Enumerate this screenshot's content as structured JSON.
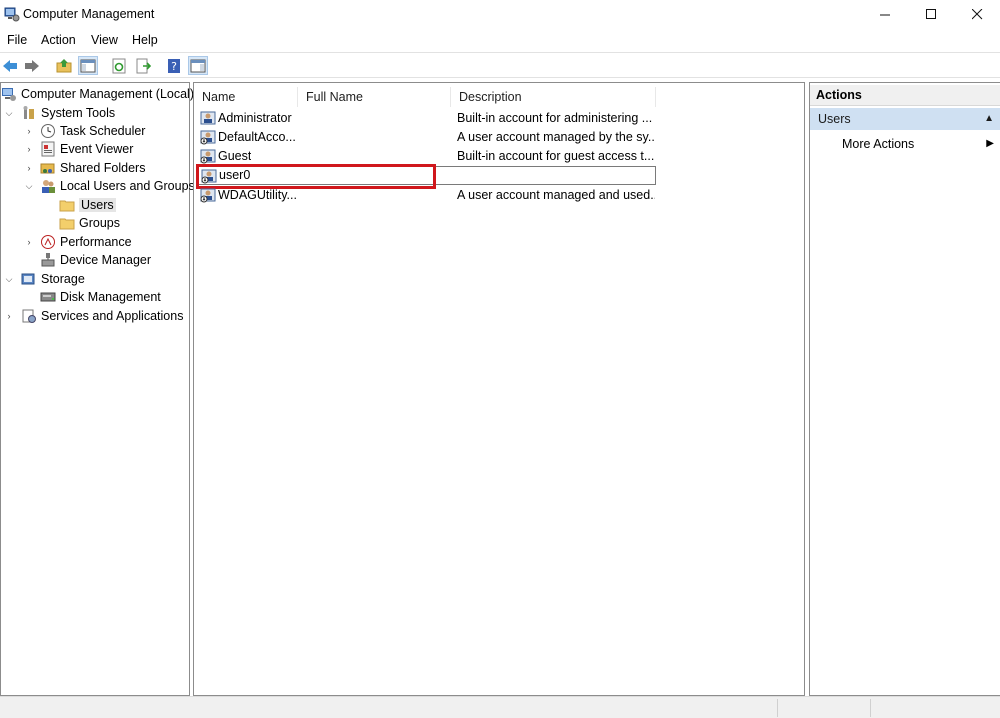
{
  "window": {
    "title": "Computer Management"
  },
  "menu": [
    "File",
    "Action",
    "View",
    "Help"
  ],
  "toolbar": {
    "icons": [
      "back-icon",
      "forward-icon",
      "up-folder-icon",
      "show-hide-tree-icon",
      "refresh-icon",
      "export-list-icon",
      "help-icon",
      "properties-icon"
    ]
  },
  "tree": {
    "root": "Computer Management (Local)",
    "system_tools": "System Tools",
    "task_scheduler": "Task Scheduler",
    "event_viewer": "Event Viewer",
    "shared_folders": "Shared Folders",
    "local_users_groups": "Local Users and Groups",
    "users": "Users",
    "groups": "Groups",
    "performance": "Performance",
    "device_manager": "Device Manager",
    "storage": "Storage",
    "disk_management": "Disk Management",
    "services_apps": "Services and Applications"
  },
  "list": {
    "columns": [
      "Name",
      "Full Name",
      "Description"
    ],
    "rows": [
      {
        "name": "Administrator",
        "full_name": "",
        "description": "Built-in account for administering ..."
      },
      {
        "name": "DefaultAcco...",
        "full_name": "",
        "description": "A user account managed by the sy..."
      },
      {
        "name": "Guest",
        "full_name": "",
        "description": "Built-in account for guest access t..."
      },
      {
        "name": "user0",
        "full_name": "",
        "description": ""
      },
      {
        "name": "WDAGUtility...",
        "full_name": "",
        "description": "A user account managed and used..."
      }
    ]
  },
  "actions": {
    "header": "Actions",
    "section": "Users",
    "more_actions": "More Actions"
  },
  "colors": {
    "highlight": "#d0171c",
    "selection": "#cfe0f2"
  }
}
